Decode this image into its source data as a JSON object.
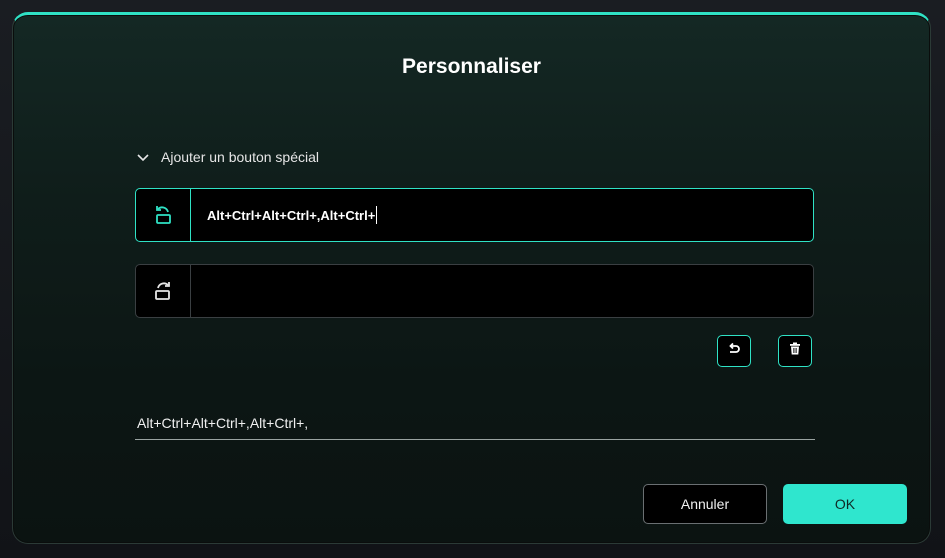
{
  "dialog": {
    "title": "Personnaliser",
    "accent_color": "#2fe2c5",
    "section": {
      "label": "Ajouter un bouton spécial",
      "icon": "chevron-down-icon"
    },
    "key_rows": [
      {
        "icon": "rotate-left-icon",
        "value": "Alt+Ctrl+Alt+Ctrl+,Alt+Ctrl+",
        "active": true
      },
      {
        "icon": "rotate-right-icon",
        "value": "",
        "active": false
      }
    ],
    "actions": {
      "undo_icon": "undo-icon",
      "delete_icon": "trash-icon"
    },
    "summary": "Alt+Ctrl+Alt+Ctrl+,Alt+Ctrl+,",
    "buttons": {
      "cancel_label": "Annuler",
      "ok_label": "OK"
    }
  }
}
